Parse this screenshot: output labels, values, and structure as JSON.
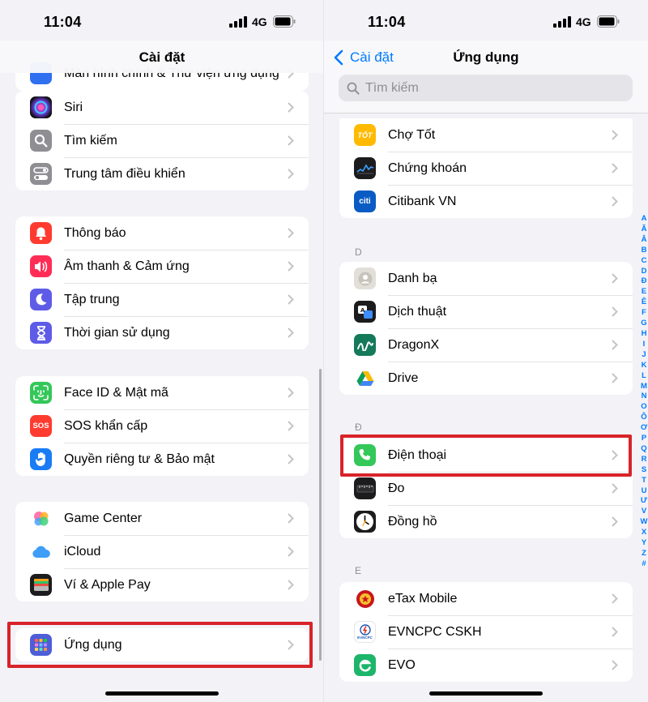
{
  "left": {
    "status": {
      "time": "11:04",
      "network": "4G"
    },
    "nav_title": "Cài đặt",
    "partial_item": "Màn hình chính & Thư viện ứng dụng",
    "group1": [
      {
        "label": "Siri",
        "icon": "siri-icon"
      },
      {
        "label": "Tìm kiếm",
        "icon": "search-icon"
      },
      {
        "label": "Trung tâm điều khiển",
        "icon": "control-center-icon"
      }
    ],
    "group2": [
      {
        "label": "Thông báo",
        "icon": "bell-icon"
      },
      {
        "label": "Âm thanh & Cảm ứng",
        "icon": "speaker-icon"
      },
      {
        "label": "Tập trung",
        "icon": "moon-icon"
      },
      {
        "label": "Thời gian sử dụng",
        "icon": "hourglass-icon"
      }
    ],
    "group3": [
      {
        "label": "Face ID & Mật mã",
        "icon": "face-id-icon"
      },
      {
        "label": "SOS khẩn cấp",
        "icon": "sos-icon",
        "badge": "SOS"
      },
      {
        "label": "Quyền riêng tư & Bảo mật",
        "icon": "hand-icon"
      }
    ],
    "group4": [
      {
        "label": "Game Center",
        "icon": "game-center-icon"
      },
      {
        "label": "iCloud",
        "icon": "cloud-icon"
      },
      {
        "label": "Ví & Apple Pay",
        "icon": "wallet-icon"
      }
    ],
    "group5": [
      {
        "label": "Ứng dụng",
        "icon": "apps-grid-icon"
      }
    ]
  },
  "right": {
    "status": {
      "time": "11:04",
      "network": "4G"
    },
    "back_label": "Cài đặt",
    "nav_title": "Ứng dụng",
    "search_placeholder": "Tìm kiếm",
    "groupC": [
      {
        "label": "Chợ Tốt",
        "icon": "cho-tot-icon",
        "badge": "TỐT"
      },
      {
        "label": "Chứng khoán",
        "icon": "stocks-icon"
      },
      {
        "label": "Citibank VN",
        "icon": "citibank-icon",
        "badge": "citi"
      }
    ],
    "section_D": "D",
    "groupD": [
      {
        "label": "Danh bạ",
        "icon": "contacts-icon"
      },
      {
        "label": "Dịch thuật",
        "icon": "translate-icon"
      },
      {
        "label": "DragonX",
        "icon": "dragonx-icon"
      },
      {
        "label": "Drive",
        "icon": "drive-icon"
      }
    ],
    "section_DD": "Đ",
    "groupDD": [
      {
        "label": "Điện thoại",
        "icon": "phone-icon"
      },
      {
        "label": "Đo",
        "icon": "measure-icon"
      },
      {
        "label": "Đồng hồ",
        "icon": "clock-icon"
      }
    ],
    "section_E": "E",
    "groupE": [
      {
        "label": "eTax Mobile",
        "icon": "etax-icon"
      },
      {
        "label": "EVNCPC CSKH",
        "icon": "evncpc-icon",
        "badge": "EVNCPC"
      },
      {
        "label": "EVO",
        "icon": "evo-icon"
      }
    ],
    "index_letters": [
      "A",
      "Ă",
      "Â",
      "B",
      "C",
      "D",
      "Đ",
      "E",
      "Ê",
      "F",
      "G",
      "H",
      "I",
      "J",
      "K",
      "L",
      "M",
      "N",
      "O",
      "Ô",
      "Ơ",
      "P",
      "Q",
      "R",
      "S",
      "T",
      "U",
      "Ư",
      "V",
      "W",
      "X",
      "Y",
      "Z",
      "#"
    ]
  },
  "colors": {
    "ios_blue": "#007aff",
    "highlight_red": "#d8232a",
    "background": "#f2f2f7"
  }
}
